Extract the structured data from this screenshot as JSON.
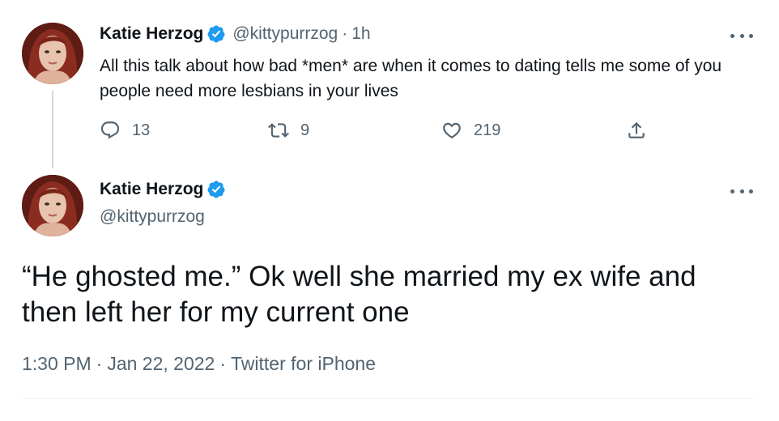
{
  "colors": {
    "accent": "#1d9bf0",
    "secondary_text": "#536471",
    "primary_text": "#0f1419"
  },
  "tweet1": {
    "author_name": "Katie Herzog",
    "handle": "@kittypurrzog",
    "separator": "·",
    "time": "1h",
    "text": "All this talk about how bad *men* are when it comes to dating tells me some of you people need more lesbians in your lives",
    "replies": "13",
    "retweets": "9",
    "likes": "219",
    "verified_icon": "verified-badge-icon",
    "more_icon": "more-options-icon"
  },
  "tweet2": {
    "author_name": "Katie Herzog",
    "handle": "@kittypurrzog",
    "text": "“He ghosted me.” Ok well she married my ex wife and then left her for my current one",
    "time": "1:30 PM",
    "date": "Jan 22, 2022",
    "source": "Twitter for iPhone",
    "separator": "·"
  }
}
